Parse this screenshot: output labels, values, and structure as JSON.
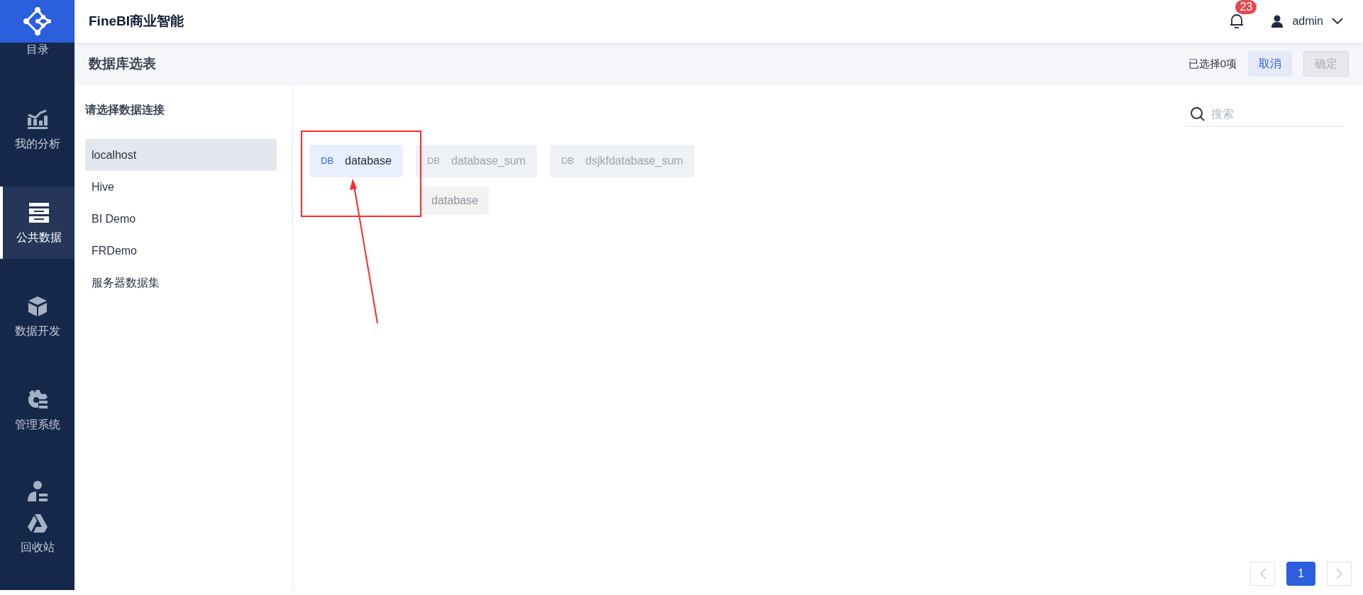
{
  "app": {
    "title": "FineBI商业智能"
  },
  "nav": [
    {
      "label": "目录",
      "selected": false
    },
    {
      "label": "我的分析",
      "selected": false
    },
    {
      "label": "公共数据",
      "selected": true
    },
    {
      "label": "数据开发",
      "selected": false
    },
    {
      "label": "管理系统",
      "selected": false
    },
    {
      "label": "回收站",
      "selected": false
    }
  ],
  "topbar": {
    "notification_count": "23",
    "user": "admin"
  },
  "header": {
    "title": "数据库选表",
    "selection_count": "已选择0项",
    "cancel": "取消",
    "confirm": {
      "label": "确定",
      "disabled": true
    }
  },
  "connections": {
    "title": "请选择数据连接",
    "items": [
      {
        "label": "localhost",
        "selected": true
      },
      {
        "label": "Hive",
        "selected": false
      },
      {
        "label": "BI Demo",
        "selected": false
      },
      {
        "label": "FRDemo",
        "selected": false
      },
      {
        "label": "服务器数据集",
        "selected": false
      }
    ]
  },
  "search": {
    "placeholder": "搜索"
  },
  "tables": [
    {
      "badge": "DB",
      "label": "database",
      "selected": true
    },
    {
      "badge": "DB",
      "label": "database_sum",
      "selected": false
    },
    {
      "badge": "DB",
      "label": "dsjkfdatabase_sum",
      "selected": false
    }
  ],
  "drag_ghost": {
    "label": "database"
  },
  "pagination": {
    "pages": [
      {
        "label": "1",
        "selected": true
      }
    ]
  }
}
